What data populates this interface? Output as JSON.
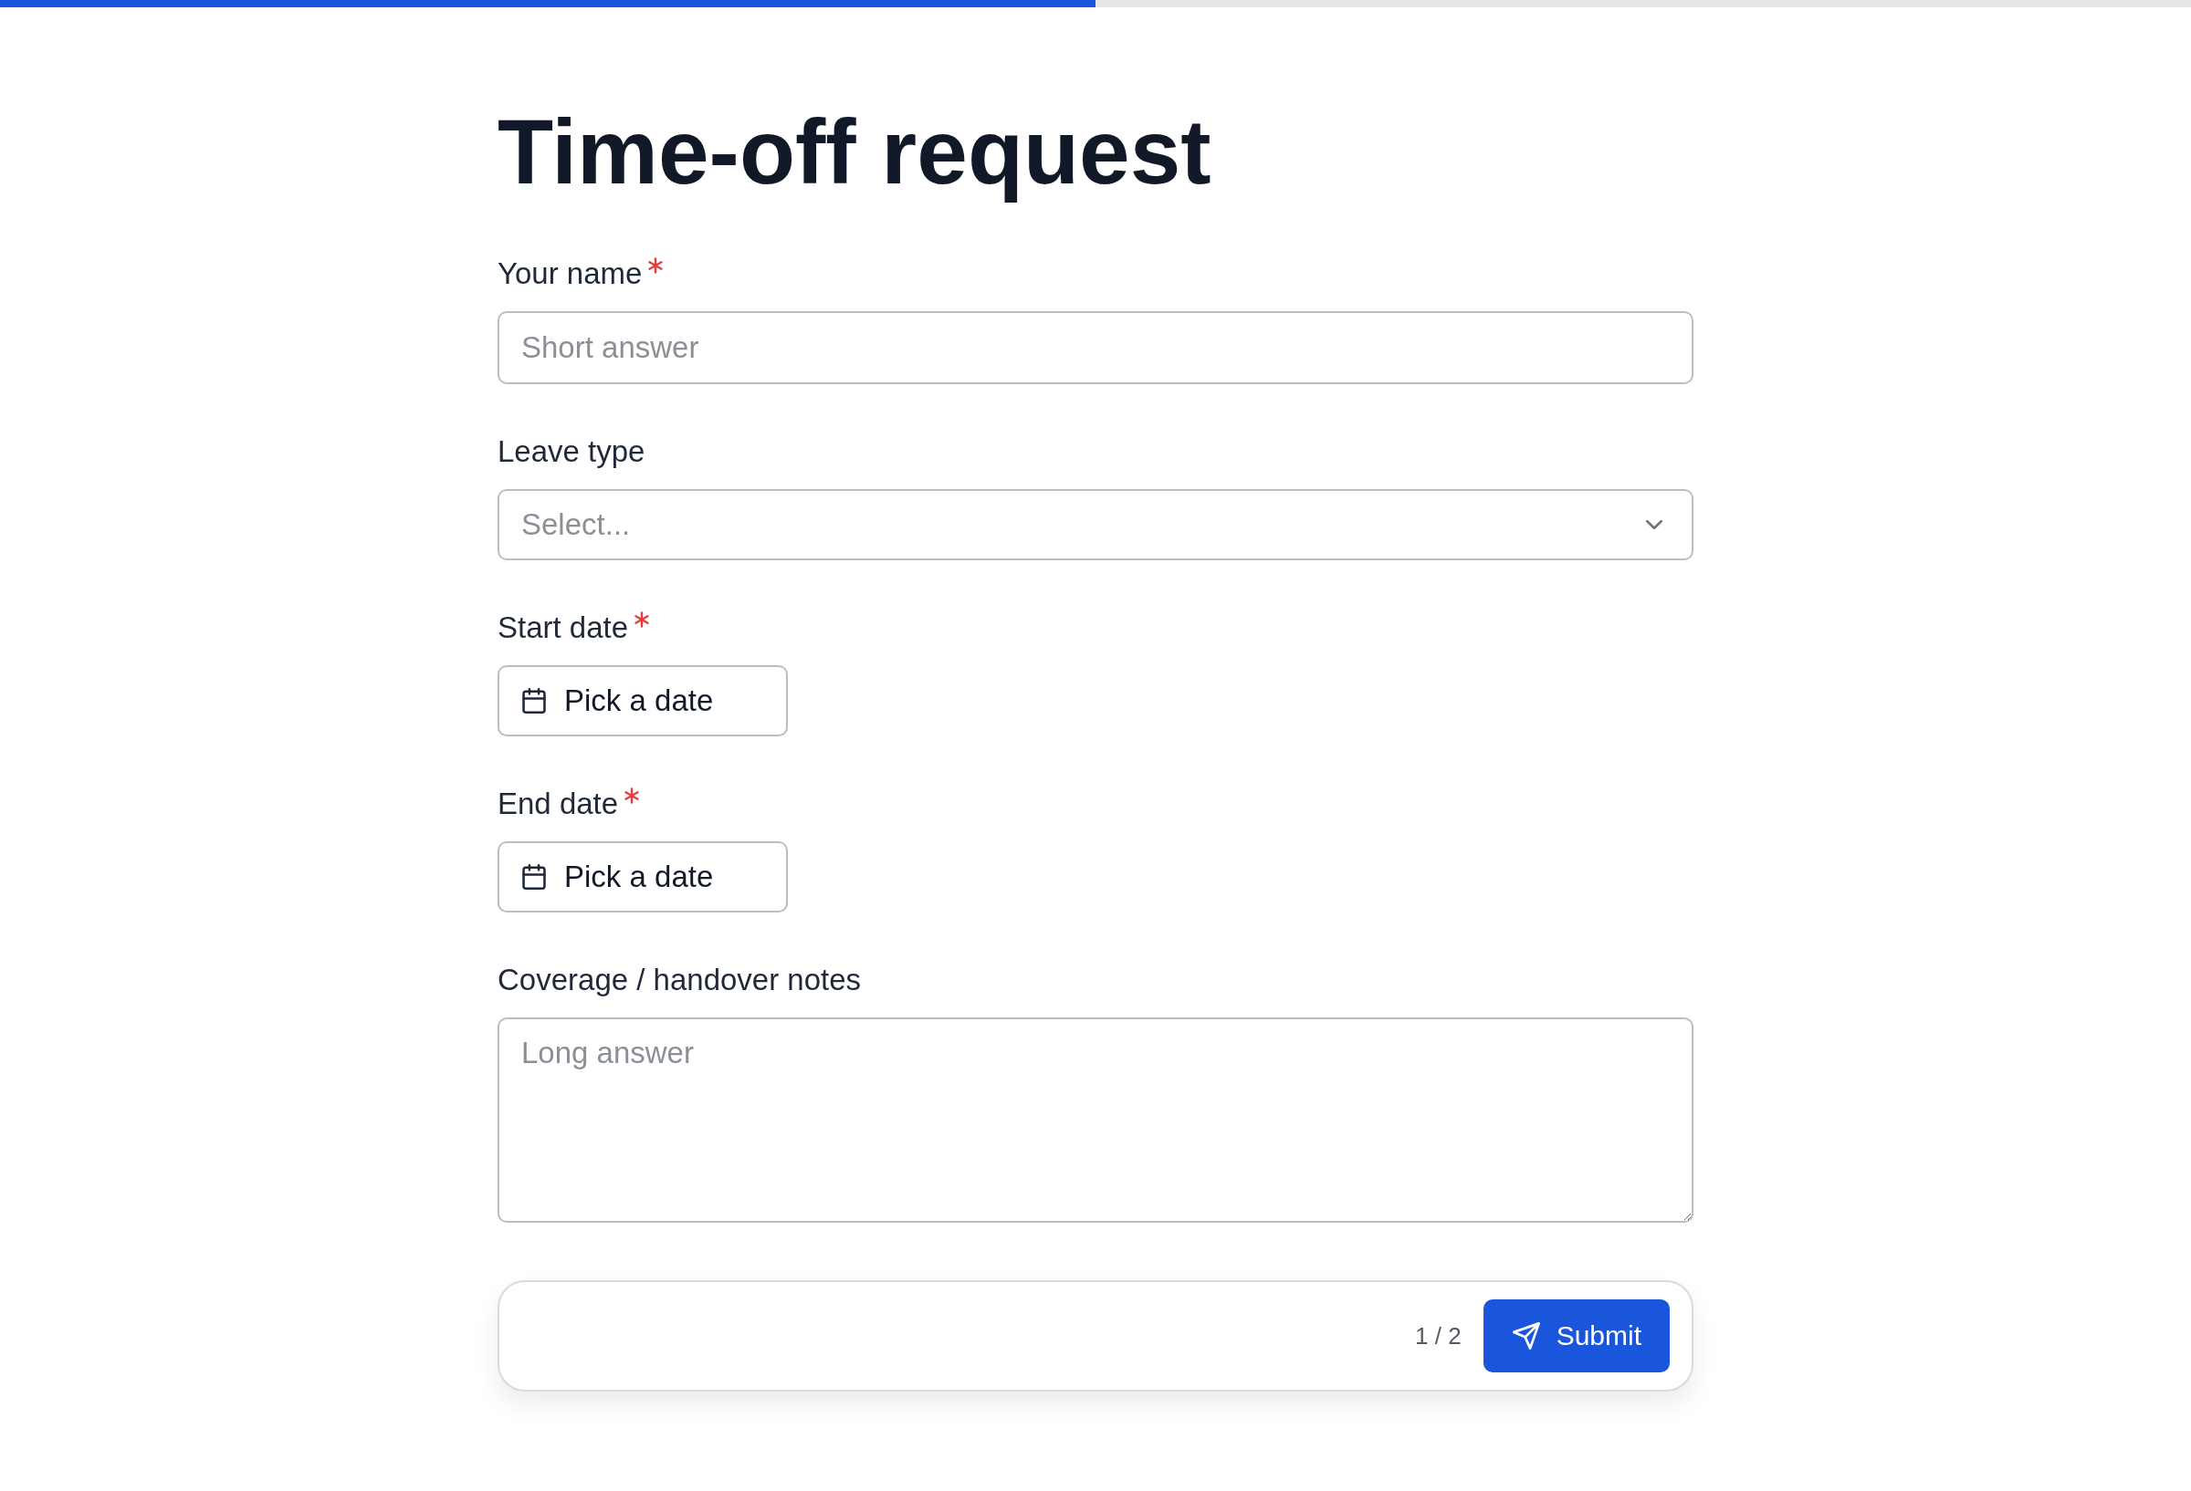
{
  "progress": {
    "level": 0.5
  },
  "title": "Time-off request",
  "fields": [
    {
      "kind": "text",
      "label": "Your name",
      "required": true,
      "placeholder": "Short answer"
    },
    {
      "kind": "select",
      "label": "Leave type",
      "required": false,
      "placeholder": "Select..."
    },
    {
      "kind": "date",
      "label": "Start date",
      "required": true,
      "button": "Pick a date"
    },
    {
      "kind": "date",
      "label": "End date",
      "required": true,
      "button": "Pick a date"
    },
    {
      "kind": "textarea",
      "label": "Coverage / handover notes",
      "required": false,
      "placeholder": "Long answer"
    }
  ],
  "footer": {
    "page": "1 / 2",
    "submit": "Submit"
  }
}
